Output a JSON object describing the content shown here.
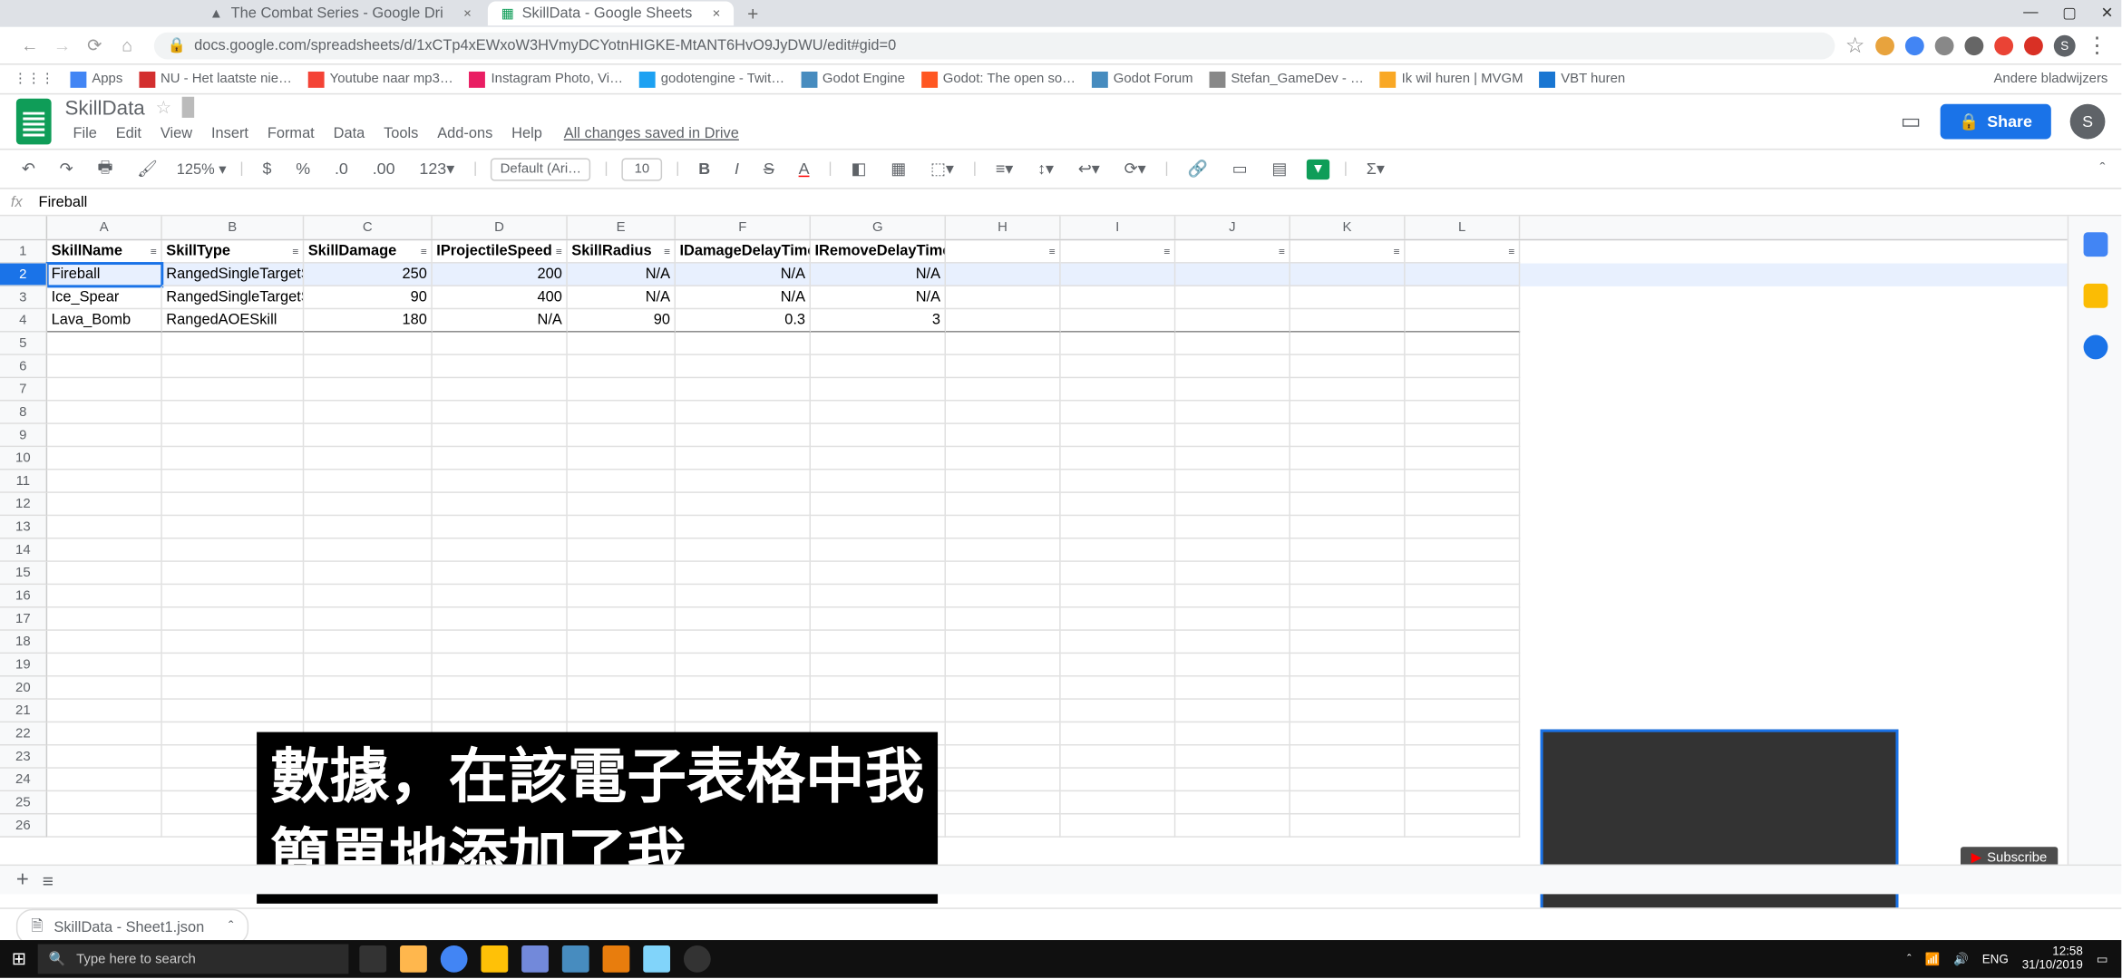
{
  "browser": {
    "tabs": [
      {
        "title": "The Combat Series - Google Dri",
        "active": false
      },
      {
        "title": "SkillData - Google Sheets",
        "active": true
      }
    ],
    "url": "docs.google.com/spreadsheets/d/1xCTp4xEWxoW3HVmyDCYotnHIGKE-MtANT6HvO9JyDWU/edit#gid=0",
    "bookmarks": [
      "Apps",
      "NU - Het laatste nie…",
      "Youtube naar mp3…",
      "Instagram Photo, Vi…",
      "godotengine - Twit…",
      "Godot Engine",
      "Godot: The open so…",
      "Godot Forum",
      "Stefan_GameDev - …",
      "Ik wil huren | MVGM",
      "VBT huren"
    ],
    "other_bookmarks": "Andere bladwijzers"
  },
  "sheets": {
    "doc_title": "SkillData",
    "menus": [
      "File",
      "Edit",
      "View",
      "Insert",
      "Format",
      "Data",
      "Tools",
      "Add-ons",
      "Help"
    ],
    "saved": "All changes saved in Drive",
    "zoom": "125%",
    "font": "Default (Ari…",
    "font_size": "10",
    "num_format": "123▾",
    "share": "Share",
    "avatar": "S"
  },
  "formula_bar": {
    "value": "Fireball"
  },
  "columns": [
    "A",
    "B",
    "C",
    "D",
    "E",
    "F",
    "G",
    "H",
    "I",
    "J",
    "K",
    "L"
  ],
  "headers": [
    "SkillName",
    "SkillType",
    "SkillDamage",
    "IProjectileSpeed",
    "SkillRadius",
    "IDamageDelayTime",
    "IRemoveDelayTime"
  ],
  "rows": [
    {
      "n": 2,
      "sel": true,
      "d": [
        "Fireball",
        "RangedSingleTargetSkill",
        "250",
        "200",
        "N/A",
        "N/A",
        "N/A"
      ]
    },
    {
      "n": 3,
      "d": [
        "Ice_Spear",
        "RangedSingleTargetSkill",
        "90",
        "400",
        "N/A",
        "N/A",
        "N/A"
      ]
    },
    {
      "n": 4,
      "d": [
        "Lava_Bomb",
        "RangedAOESkill",
        "180",
        "N/A",
        "90",
        "0.3",
        "3"
      ]
    }
  ],
  "empty_rows": [
    5,
    6,
    7,
    8,
    9,
    10,
    11,
    12,
    13,
    14,
    15,
    16,
    17,
    18,
    19,
    20,
    21,
    22,
    23,
    24,
    25,
    26
  ],
  "subtitle": {
    "line1": "數據，在該電子表格中我",
    "line2": "簡單地添加了我"
  },
  "subscribe": "Subscribe",
  "download": {
    "file": "SkillData - Sheet1.json"
  },
  "taskbar": {
    "search": "Type here to search",
    "lang": "ENG",
    "time": "12:58",
    "date": "31/10/2019"
  }
}
